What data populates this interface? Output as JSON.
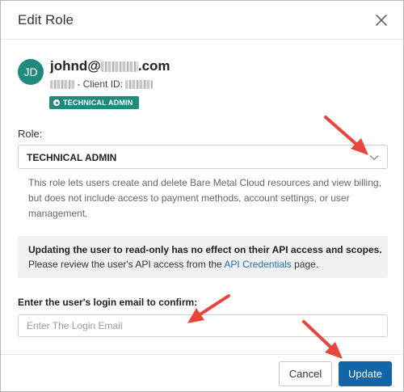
{
  "dialog": {
    "title": "Edit Role",
    "close_icon": "close-icon"
  },
  "user": {
    "initials": "JD",
    "email_prefix": "johnd@",
    "email_suffix": ".com",
    "client_id_label": "- Client ID:",
    "badge_label": "TECHNICAL ADMIN"
  },
  "role": {
    "label": "Role:",
    "selected": "TECHNICAL ADMIN",
    "description": "This role lets users create and delete Bare Metal Cloud resources and view billing, but does not include access to payment methods, account settings, or user management."
  },
  "notice": {
    "strong": "Updating the user to read-only has no effect on their API access and scopes.",
    "text_before": "Please review the user's API access from the",
    "link": "API Credentials",
    "text_after": "page."
  },
  "confirm": {
    "label": "Enter the user's login email to confirm:",
    "placeholder": "Enter The Login Email",
    "value": ""
  },
  "footer": {
    "cancel_label": "Cancel",
    "update_label": "Update"
  },
  "colors": {
    "accent": "#1f8a7d",
    "primary_button": "#1266a8",
    "link": "#1f6fb3",
    "annotation_arrow": "#e8453c"
  }
}
